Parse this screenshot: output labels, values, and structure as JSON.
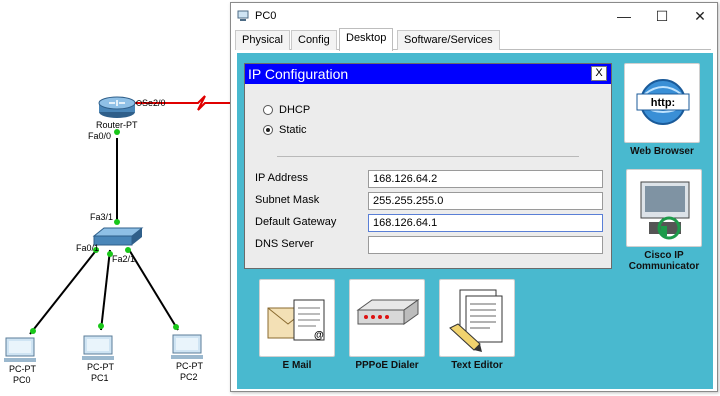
{
  "topology": {
    "router": {
      "name": "Router-PT",
      "port_serial": "Se2/0",
      "port_fa": "Fa0/0"
    },
    "switch": {
      "port_up": "Fa3/1",
      "port_left": "Fa0/1",
      "port_right": "Fa2/1"
    },
    "pcs": [
      {
        "type": "PC-PT",
        "name": "PC0"
      },
      {
        "type": "PC-PT",
        "name": "PC1"
      },
      {
        "type": "PC-PT",
        "name": "PC2"
      }
    ],
    "link_status_color": "#19c719",
    "serial_link_color": "#e00000"
  },
  "window": {
    "title": "PC0",
    "tabs": [
      "Physical",
      "Config",
      "Desktop",
      "Software/Services"
    ],
    "active_tab": "Desktop"
  },
  "desktop": {
    "background": "#49b9cf",
    "apps": [
      {
        "label": "Web Browser",
        "icon": "web-browser-icon"
      },
      {
        "label": "Cisco IP Communicator",
        "line1": "Cisco IP",
        "line2": "Communicator",
        "icon": "ip-phone-icon"
      },
      {
        "label": "E Mail",
        "icon": "email-icon"
      },
      {
        "label": "PPPoE Dialer",
        "icon": "pppoe-dialer-icon"
      },
      {
        "label": "Text Editor",
        "icon": "text-editor-icon"
      }
    ]
  },
  "ip_config": {
    "title": "IP Configuration",
    "close_label": "X",
    "mode_options": [
      "DHCP",
      "Static"
    ],
    "selected_mode": "Static",
    "fields": {
      "ip_address": {
        "label": "IP Address",
        "value": "168.126.64.2"
      },
      "subnet_mask": {
        "label": "Subnet Mask",
        "value": "255.255.255.0"
      },
      "default_gateway": {
        "label": "Default Gateway",
        "value": "168.126.64.1"
      },
      "dns_server": {
        "label": "DNS Server",
        "value": ""
      }
    }
  }
}
